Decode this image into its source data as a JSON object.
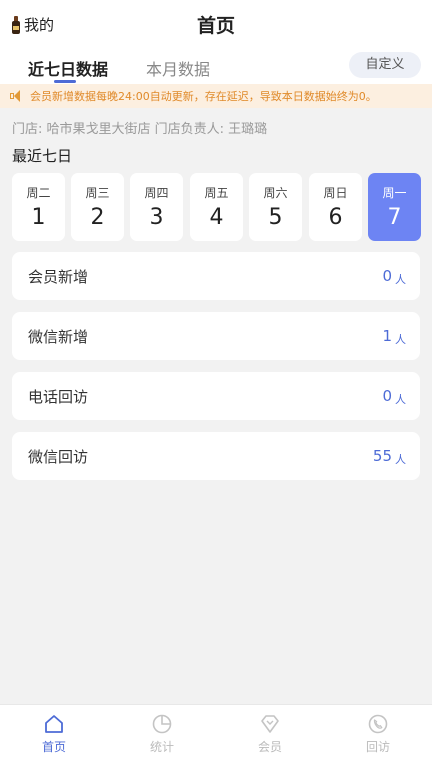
{
  "header": {
    "me_label": "我的",
    "title": "首页"
  },
  "tabs": {
    "items": [
      {
        "label": "近七日数据",
        "active": true
      },
      {
        "label": "本月数据",
        "active": false
      }
    ],
    "custom_button": "自定义"
  },
  "notice": {
    "text": "会员新增数据每晚24:00自动更新，存在延迟，导致本日数据始终为0。"
  },
  "store": {
    "line": "门店: 哈市果戈里大街店  门店负责人: 王璐璐"
  },
  "section_title": "最近七日",
  "days": [
    {
      "weekday": "周二",
      "date": "1",
      "selected": false
    },
    {
      "weekday": "周三",
      "date": "2",
      "selected": false
    },
    {
      "weekday": "周四",
      "date": "3",
      "selected": false
    },
    {
      "weekday": "周五",
      "date": "4",
      "selected": false
    },
    {
      "weekday": "周六",
      "date": "5",
      "selected": false
    },
    {
      "weekday": "周日",
      "date": "6",
      "selected": false
    },
    {
      "weekday": "周一",
      "date": "7",
      "selected": true
    }
  ],
  "stats": [
    {
      "label": "会员新增",
      "value": "0",
      "unit": "人"
    },
    {
      "label": "微信新增",
      "value": "1",
      "unit": "人"
    },
    {
      "label": "电话回访",
      "value": "0",
      "unit": "人"
    },
    {
      "label": "微信回访",
      "value": "55",
      "unit": "人"
    }
  ],
  "bottom_nav": [
    {
      "label": "首页",
      "icon": "home-icon",
      "active": true
    },
    {
      "label": "统计",
      "icon": "pie-chart-icon",
      "active": false
    },
    {
      "label": "会员",
      "icon": "diamond-icon",
      "active": false
    },
    {
      "label": "回访",
      "icon": "phone-icon",
      "active": false
    }
  ],
  "colors": {
    "accent": "#4d6bd6",
    "selected_day": "#6d84f3",
    "notice_bg": "#fcefe0",
    "notice_text": "#e08a2a"
  }
}
